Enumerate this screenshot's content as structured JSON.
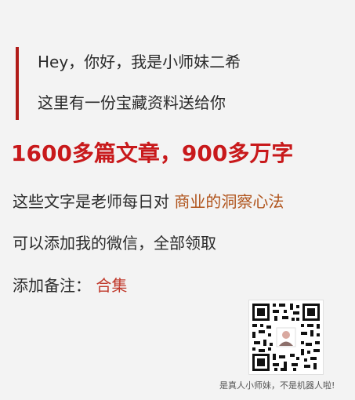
{
  "intro": {
    "greeting": "Hey，你好，我是小师妹二希",
    "gift": "这里有一份宝藏资料送给你"
  },
  "headline": "1600多篇文章，900多万字",
  "words_line": {
    "prefix": "这些文字是老师每日对",
    "highlight": "商业的洞察心法"
  },
  "wechat_line": "可以添加我的微信，全部领取",
  "note_line": {
    "prefix": "添加备注：",
    "highlight": "合集"
  },
  "qr": {
    "caption": "是真人小师妹，不是机器人啦!"
  },
  "colors": {
    "accent_red": "#c8191b",
    "highlight_orange": "#b0541c"
  }
}
